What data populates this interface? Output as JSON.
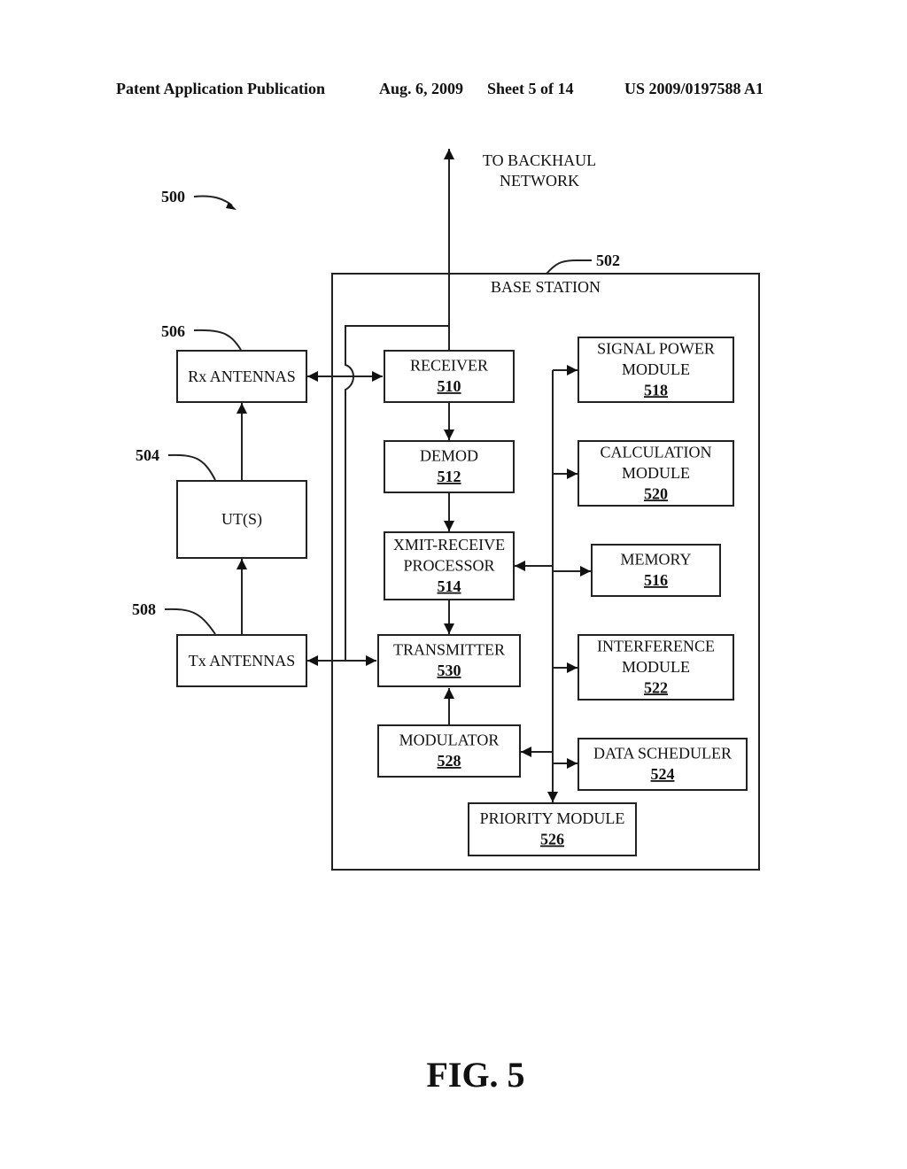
{
  "header": {
    "publication": "Patent Application Publication",
    "date": "Aug. 6, 2009",
    "sheet": "Sheet 5 of 14",
    "number": "US 2009/0197588 A1"
  },
  "figure": {
    "ref": "500",
    "caption": "FIG. 5",
    "backhaul_line1": "TO BACKHAUL",
    "backhaul_line2": "NETWORK"
  },
  "base_station": {
    "label": "BASE STATION",
    "ref": "502"
  },
  "external": {
    "rx": {
      "label": "Rx ANTENNAS",
      "ref": "506"
    },
    "ut": {
      "label": "UT(S)",
      "ref": "504"
    },
    "tx": {
      "label": "Tx ANTENNAS",
      "ref": "508"
    }
  },
  "blocks": {
    "receiver": {
      "lines": [
        "RECEIVER"
      ],
      "num": "510"
    },
    "demod": {
      "lines": [
        "DEMOD"
      ],
      "num": "512"
    },
    "processor": {
      "lines": [
        "XMIT-RECEIVE",
        "PROCESSOR"
      ],
      "num": "514"
    },
    "transmitter": {
      "lines": [
        "TRANSMITTER"
      ],
      "num": "530"
    },
    "modulator": {
      "lines": [
        "MODULATOR"
      ],
      "num": "528"
    },
    "signal_power": {
      "lines": [
        "SIGNAL POWER",
        "MODULE"
      ],
      "num": "518"
    },
    "calculation": {
      "lines": [
        "CALCULATION",
        "MODULE"
      ],
      "num": "520"
    },
    "memory": {
      "lines": [
        "MEMORY"
      ],
      "num": "516"
    },
    "interference": {
      "lines": [
        "INTERFERENCE",
        "MODULE"
      ],
      "num": "522"
    },
    "scheduler": {
      "lines": [
        "DATA SCHEDULER"
      ],
      "num": "524"
    },
    "priority": {
      "lines": [
        "PRIORITY MODULE"
      ],
      "num": "526"
    }
  }
}
